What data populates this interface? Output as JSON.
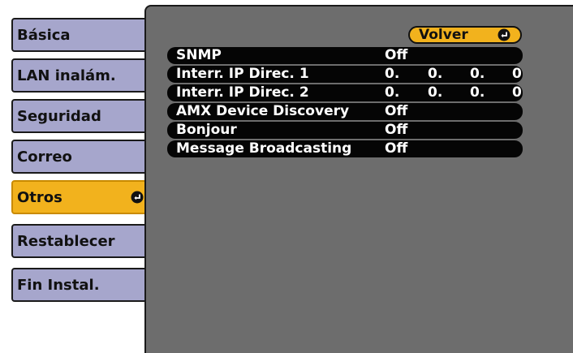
{
  "sidebar": {
    "items": [
      {
        "label": "Básica"
      },
      {
        "label": "LAN inalám."
      },
      {
        "label": "Seguridad"
      },
      {
        "label": "Correo"
      },
      {
        "label": "Otros",
        "selected": true,
        "icon": "enter-icon"
      },
      {
        "label": "Restablecer"
      },
      {
        "label": "Fin Instal."
      }
    ]
  },
  "panel": {
    "back_button": {
      "label": "Volver",
      "icon": "enter-icon"
    },
    "settings": [
      {
        "label": "SNMP",
        "value": "Off"
      },
      {
        "label": "Interr. IP Direc. 1",
        "octets": [
          "0.",
          "0.",
          "0.",
          "0"
        ]
      },
      {
        "label": "Interr. IP Direc. 2",
        "octets": [
          "0.",
          "0.",
          "0.",
          "0"
        ]
      },
      {
        "label": "AMX Device Discovery",
        "value": "Off"
      },
      {
        "label": "Bonjour",
        "value": "Off"
      },
      {
        "label": "Message Broadcasting",
        "value": "Off"
      }
    ]
  },
  "colors": {
    "tab_bg": "#a6a6cc",
    "selected_bg": "#f2b21d",
    "panel_bg": "#6d6d6d",
    "row_bg": "#050505"
  }
}
